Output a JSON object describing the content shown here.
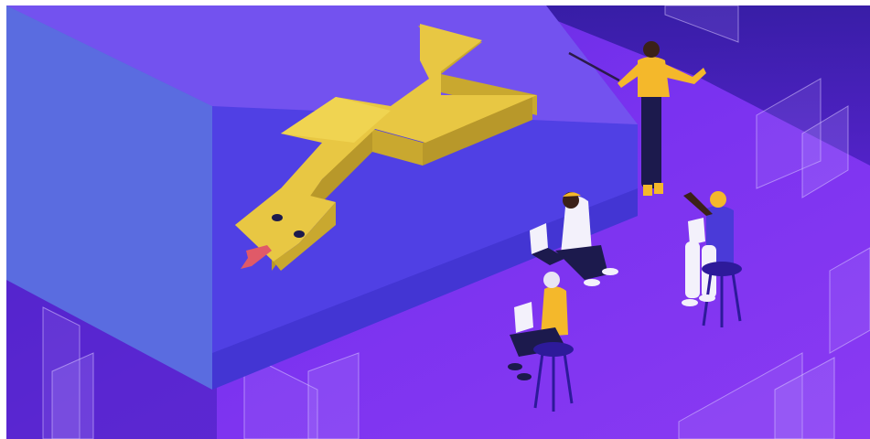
{
  "illustration": {
    "subject": "",
    "colors": {
      "background": "#7a32f0",
      "background_deep": "#4a1fc0",
      "cube_top": "#6a45ec",
      "cube_front": "#4f39e6",
      "cube_left": "#5a6ce0",
      "snake": "#e8c743",
      "snake_shadow": "#c9a82f",
      "accent_yellow": "#f4b82b",
      "figure_dark": "#1c1a4d",
      "figure_white": "#f3f1fb",
      "tongue": "#e05a68"
    },
    "icons": [
      "snake-icon",
      "laptop-icon",
      "pointer-stick-icon",
      "stool-icon"
    ]
  }
}
